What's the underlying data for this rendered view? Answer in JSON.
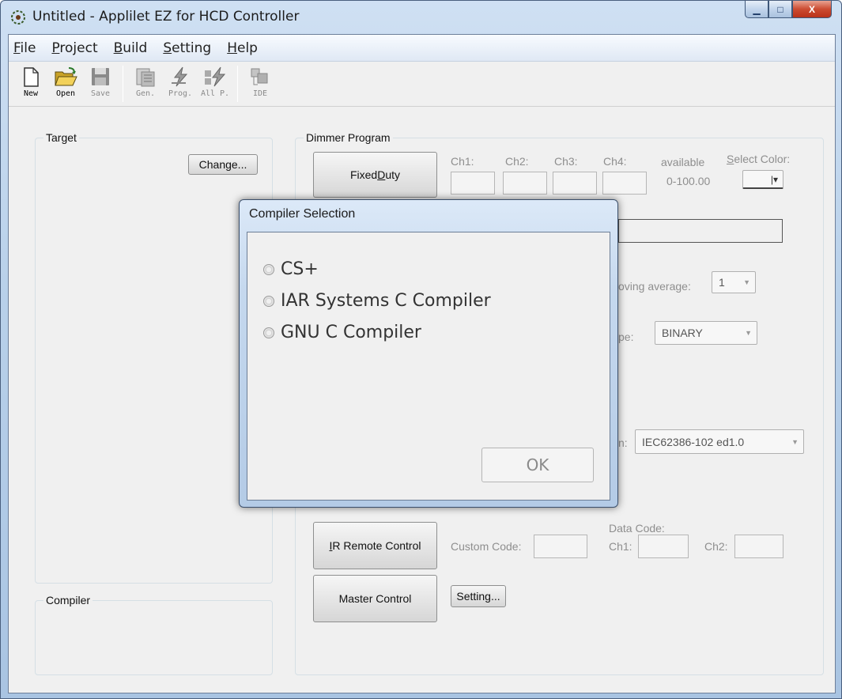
{
  "window": {
    "title": "Untitled - Applilet EZ for HCD Controller",
    "buttons": {
      "minimize": "▁",
      "maximize": "□",
      "close": "X"
    }
  },
  "menu": [
    {
      "key": "F",
      "rest": "ile"
    },
    {
      "key": "P",
      "rest": "roject"
    },
    {
      "key": "B",
      "rest": "uild"
    },
    {
      "key": "S",
      "rest": "etting"
    },
    {
      "key": "H",
      "rest": "elp"
    }
  ],
  "toolbar": {
    "new": "New",
    "open": "Open",
    "save": "Save",
    "gen": "Gen.",
    "prog": "Prog.",
    "allp": "All P.",
    "ide": "IDE"
  },
  "target": {
    "legend": "Target",
    "change_button": "Change..."
  },
  "compiler": {
    "legend": "Compiler"
  },
  "dimmer": {
    "legend": "Dimmer Program",
    "fixed_duty": {
      "pre": "Fixed ",
      "key": "D",
      "post": "uty"
    },
    "ch1": "Ch1:",
    "ch2": "Ch2:",
    "ch3": "Ch3:",
    "ch4": "Ch4:",
    "available": "available",
    "range": "0-100.00",
    "select_color": {
      "key": "S",
      "rest": "elect Color:"
    },
    "moving_average_label": "oving average:",
    "moving_average_value": "1",
    "type_label": "pe:",
    "type_value": "BINARY",
    "standard_label": "n:",
    "standard_value": "IEC62386-102 ed1.0",
    "ir_remote": {
      "key": "I",
      "rest": "R Remote Control"
    },
    "custom_code": "Custom Code:",
    "data_code": "Data Code:",
    "dc_ch1": "Ch1:",
    "dc_ch2": "Ch2:",
    "master_control": "Master Control",
    "setting_button": "Setting..."
  },
  "dialog": {
    "title": "Compiler Selection",
    "options": [
      "CS+",
      "IAR Systems C Compiler",
      "GNU C Compiler"
    ],
    "ok": "OK"
  },
  "colors": {
    "titlebar": "#b9d1ea",
    "client_bg": "#f0f0f0",
    "close_button": "#cc4c32",
    "disabled_text": "#8e8e8e"
  }
}
